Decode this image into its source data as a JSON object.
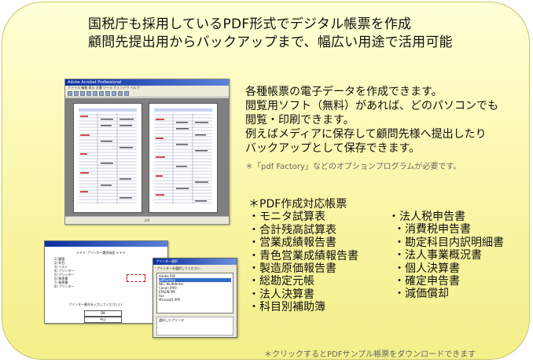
{
  "headline": {
    "line1": "国税庁も採用しているPDF形式でデジタル帳票を作成",
    "line2": "顧問先提出用からバックアップまで、幅広い用途で活用可能"
  },
  "description": {
    "lines": [
      "各種帳票の電子データを作成できます。",
      "閲覧用ソフト（無料）があれば、どのパソコンでも",
      "閲覧・印刷できます。",
      "例えばメディアに保存して顧問先様へ提出したり",
      "バックアップとして保存できます。"
    ],
    "footnote": "＊「pdf Factory」などのオプションプログラムが必要です。"
  },
  "support_list": {
    "heading": "＊PDF作成対応帳票",
    "left_items": [
      "・モニタ試算表",
      "・合計残高試算表",
      "・営業成績報告書",
      "・青色営業成績報告書",
      "・製造原価報告書",
      "・総勘定元帳",
      "・法人決算書",
      "・科目別補助簿"
    ],
    "right_heading": "・法人税申告書",
    "right_items": [
      "・消費税申告書",
      "・勘定科目内訳明細書",
      "・法人事業概況書",
      "・個人決算書",
      "・確定申告書",
      "・減価償却"
    ]
  },
  "bottom_note": "＊クリックするとPDFサンプル帳票をダウンロードできます",
  "viewer_screenshot": {
    "title": "Adobe Acrobat Professional",
    "page_indicator": "2/4"
  },
  "print_dialog_screenshot": {
    "header": "＊＊＊ プリンター選択画面 ＊＊＊",
    "rows": [
      "1) 顧客",
      "2) 科目",
      "3) リスト",
      "4) プリンター",
      "5) プリンター",
      "6) 帳票書",
      "7) 帳票書",
      "8) プリンター"
    ],
    "prompt": "プリンター番号を入力してください( )",
    "buttons": [
      "OK",
      "中止"
    ]
  },
  "printer_select_screenshot": {
    "title": "プリンター選択",
    "caption": "プリンターを選択してください",
    "printers": [
      "Adobe PDF",
      "pdfFactory",
      "NEC MultiWriter",
      "Canon iP90",
      "EPSON PM",
      "Fax",
      "Microsoft XPS"
    ],
    "info_label": "選択したプリンタ"
  },
  "colors": {
    "panel_top": "#ffffd6",
    "panel_bottom": "#f3ef8a",
    "panel_border": "#c9c56a",
    "footnote_gray": "#666666",
    "title_bar_blue": "#0a2f9e",
    "highlight_red": "#d40000"
  }
}
